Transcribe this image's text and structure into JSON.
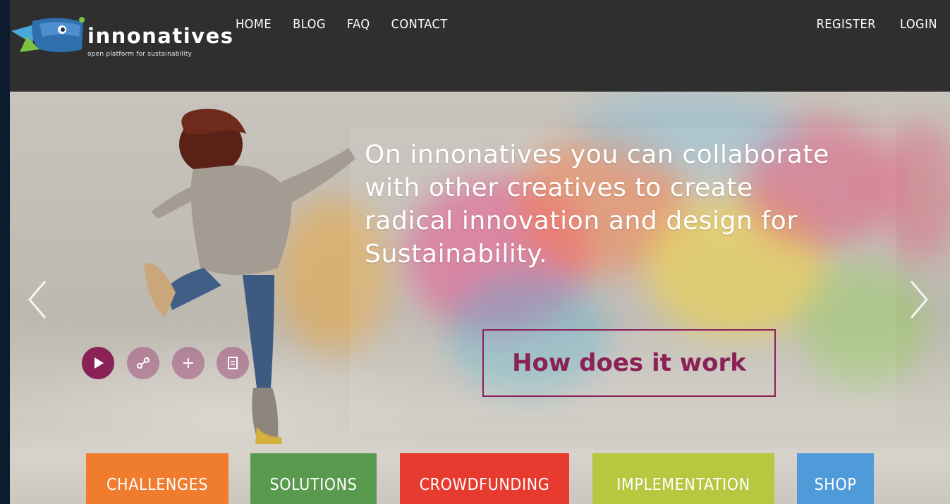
{
  "logo": {
    "name": "innonatives",
    "tagline": "open platform for sustainability"
  },
  "nav": {
    "left": [
      {
        "label": "HOME"
      },
      {
        "label": "BLOG"
      },
      {
        "label": "FAQ"
      },
      {
        "label": "CONTACT"
      }
    ],
    "right": [
      {
        "label": "REGISTER"
      },
      {
        "label": "LOGIN"
      }
    ]
  },
  "hero": {
    "lines": [
      "On innonatives you can collaborate",
      "with other creatives to create",
      "radical innovation and design for",
      "Sustainability."
    ],
    "cta": "How does it work"
  },
  "categories": [
    {
      "label": "CHALLENGES",
      "color": "#ef7d2d"
    },
    {
      "label": "SOLUTIONS",
      "color": "#5a9a4f"
    },
    {
      "label": "CROWDFUNDING",
      "color": "#e63b2e"
    },
    {
      "label": "IMPLEMENTATION",
      "color": "#b6c840"
    },
    {
      "label": "SHOP",
      "color": "#4f9ad8"
    }
  ],
  "colors": {
    "accent": "#8a2157",
    "header_bg": "#2f2f2f",
    "logo_blue": "#2f6fae"
  },
  "icons": [
    "play-icon",
    "link-icon",
    "plus-icon",
    "document-icon",
    "chevron-left-icon",
    "chevron-right-icon"
  ]
}
